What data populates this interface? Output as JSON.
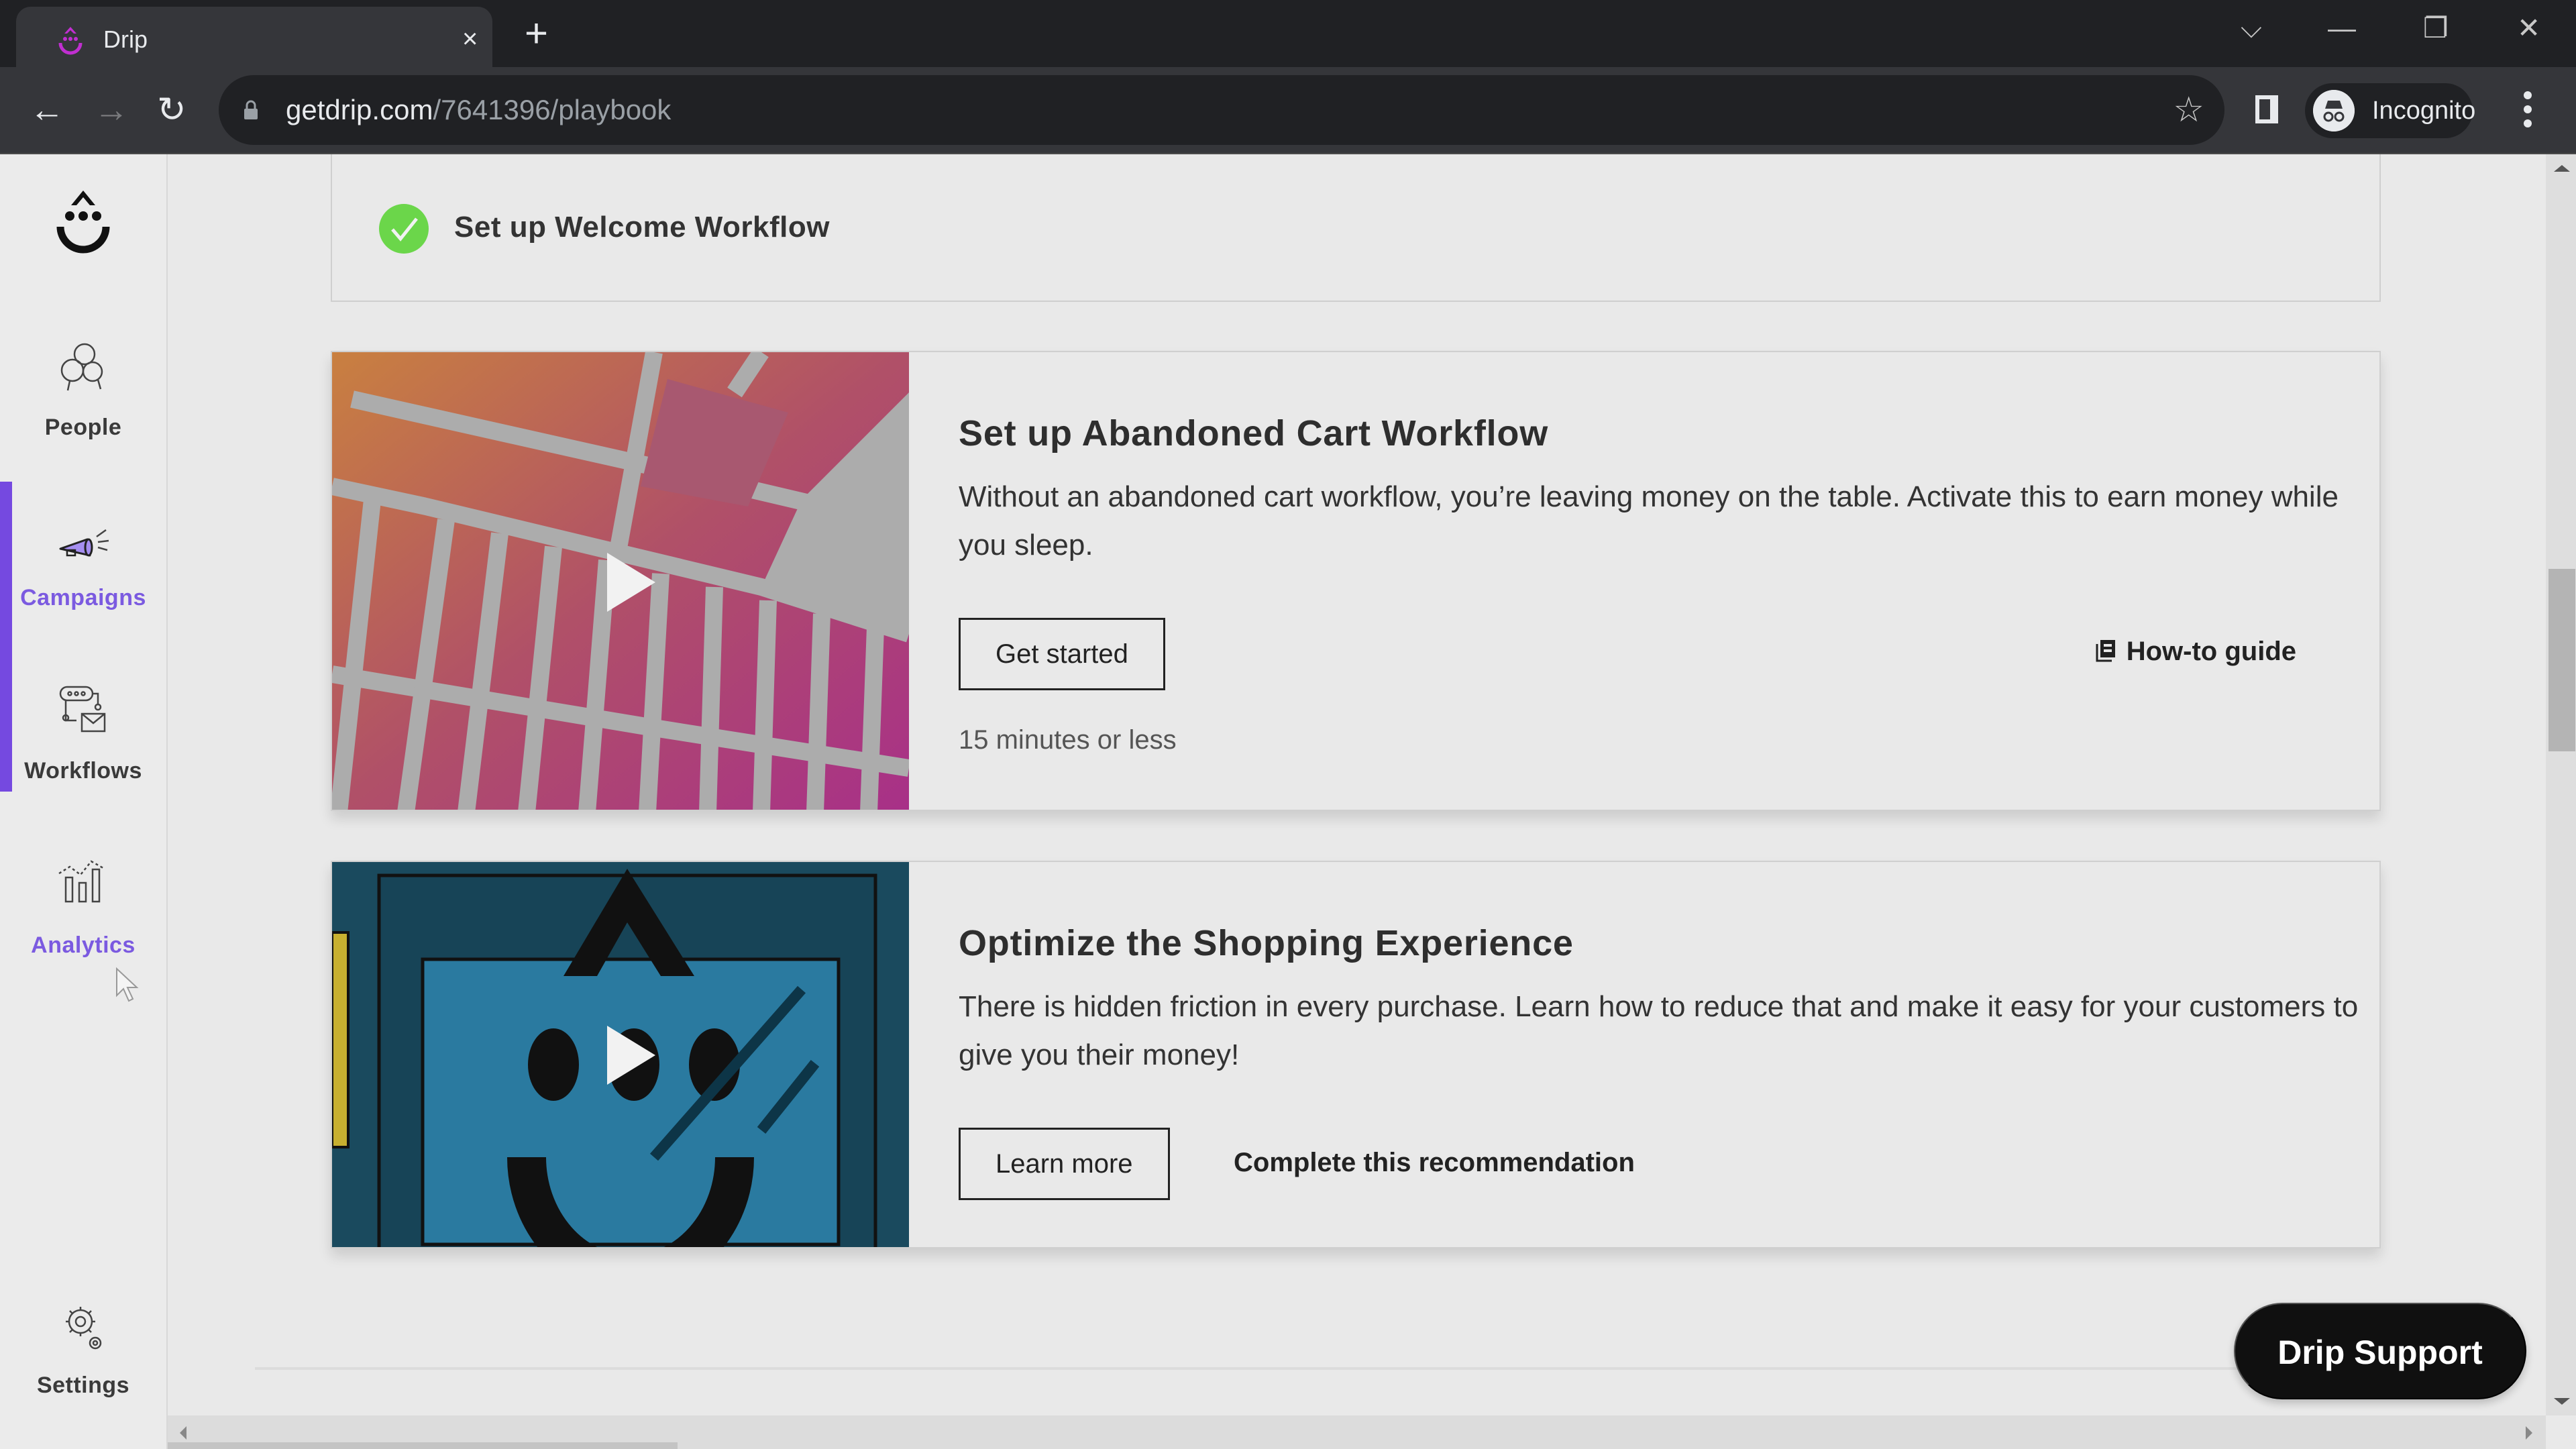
{
  "browser": {
    "tab_title": "Drip",
    "tab_close": "×",
    "new_tab": "+",
    "url_domain": "getdrip.com",
    "url_path": "/7641396/playbook",
    "profile_label": "Incognito",
    "window_controls": {
      "tab_search": "⌵",
      "minimize": "—",
      "restore": "❐",
      "close": "✕"
    },
    "nav": {
      "back": "←",
      "forward": "→",
      "reload": "↻"
    },
    "bookmark": "☆",
    "favicon_color": "#c02fd0"
  },
  "sidebar": {
    "accent_color": "#7549e0",
    "items": [
      {
        "label": "People",
        "icon": "people-icon",
        "state": "default"
      },
      {
        "label": "Campaigns",
        "icon": "megaphone-icon",
        "state": "active"
      },
      {
        "label": "Workflows",
        "icon": "workflow-icon",
        "state": "default"
      },
      {
        "label": "Analytics",
        "icon": "analytics-icon",
        "state": "hover"
      }
    ],
    "settings": {
      "label": "Settings",
      "icon": "gear-icon"
    }
  },
  "main": {
    "completed_item": {
      "title": "Set up Welcome Workflow",
      "status": "completed",
      "status_color": "#6bd64a"
    },
    "recommendations": [
      {
        "title": "Set up Abandoned Cart Workflow",
        "description": "Without an abandoned cart workflow, you’re leaving money on the table. Activate this to earn money while you sleep.",
        "primary_button": "Get started",
        "secondary_link": "How-to guide",
        "meta": "15 minutes or less",
        "thumbnail": "abandoned-cart-video"
      },
      {
        "title": "Optimize the Shopping Experience",
        "description": "There is hidden friction in every purchase. Learn how to reduce that and make it easy for your customers to give you their money!",
        "primary_button": "Learn more",
        "secondary_link": "Complete this recommendation",
        "thumbnail": "shopping-experience-video"
      }
    ]
  },
  "support_button": "Drip Support"
}
